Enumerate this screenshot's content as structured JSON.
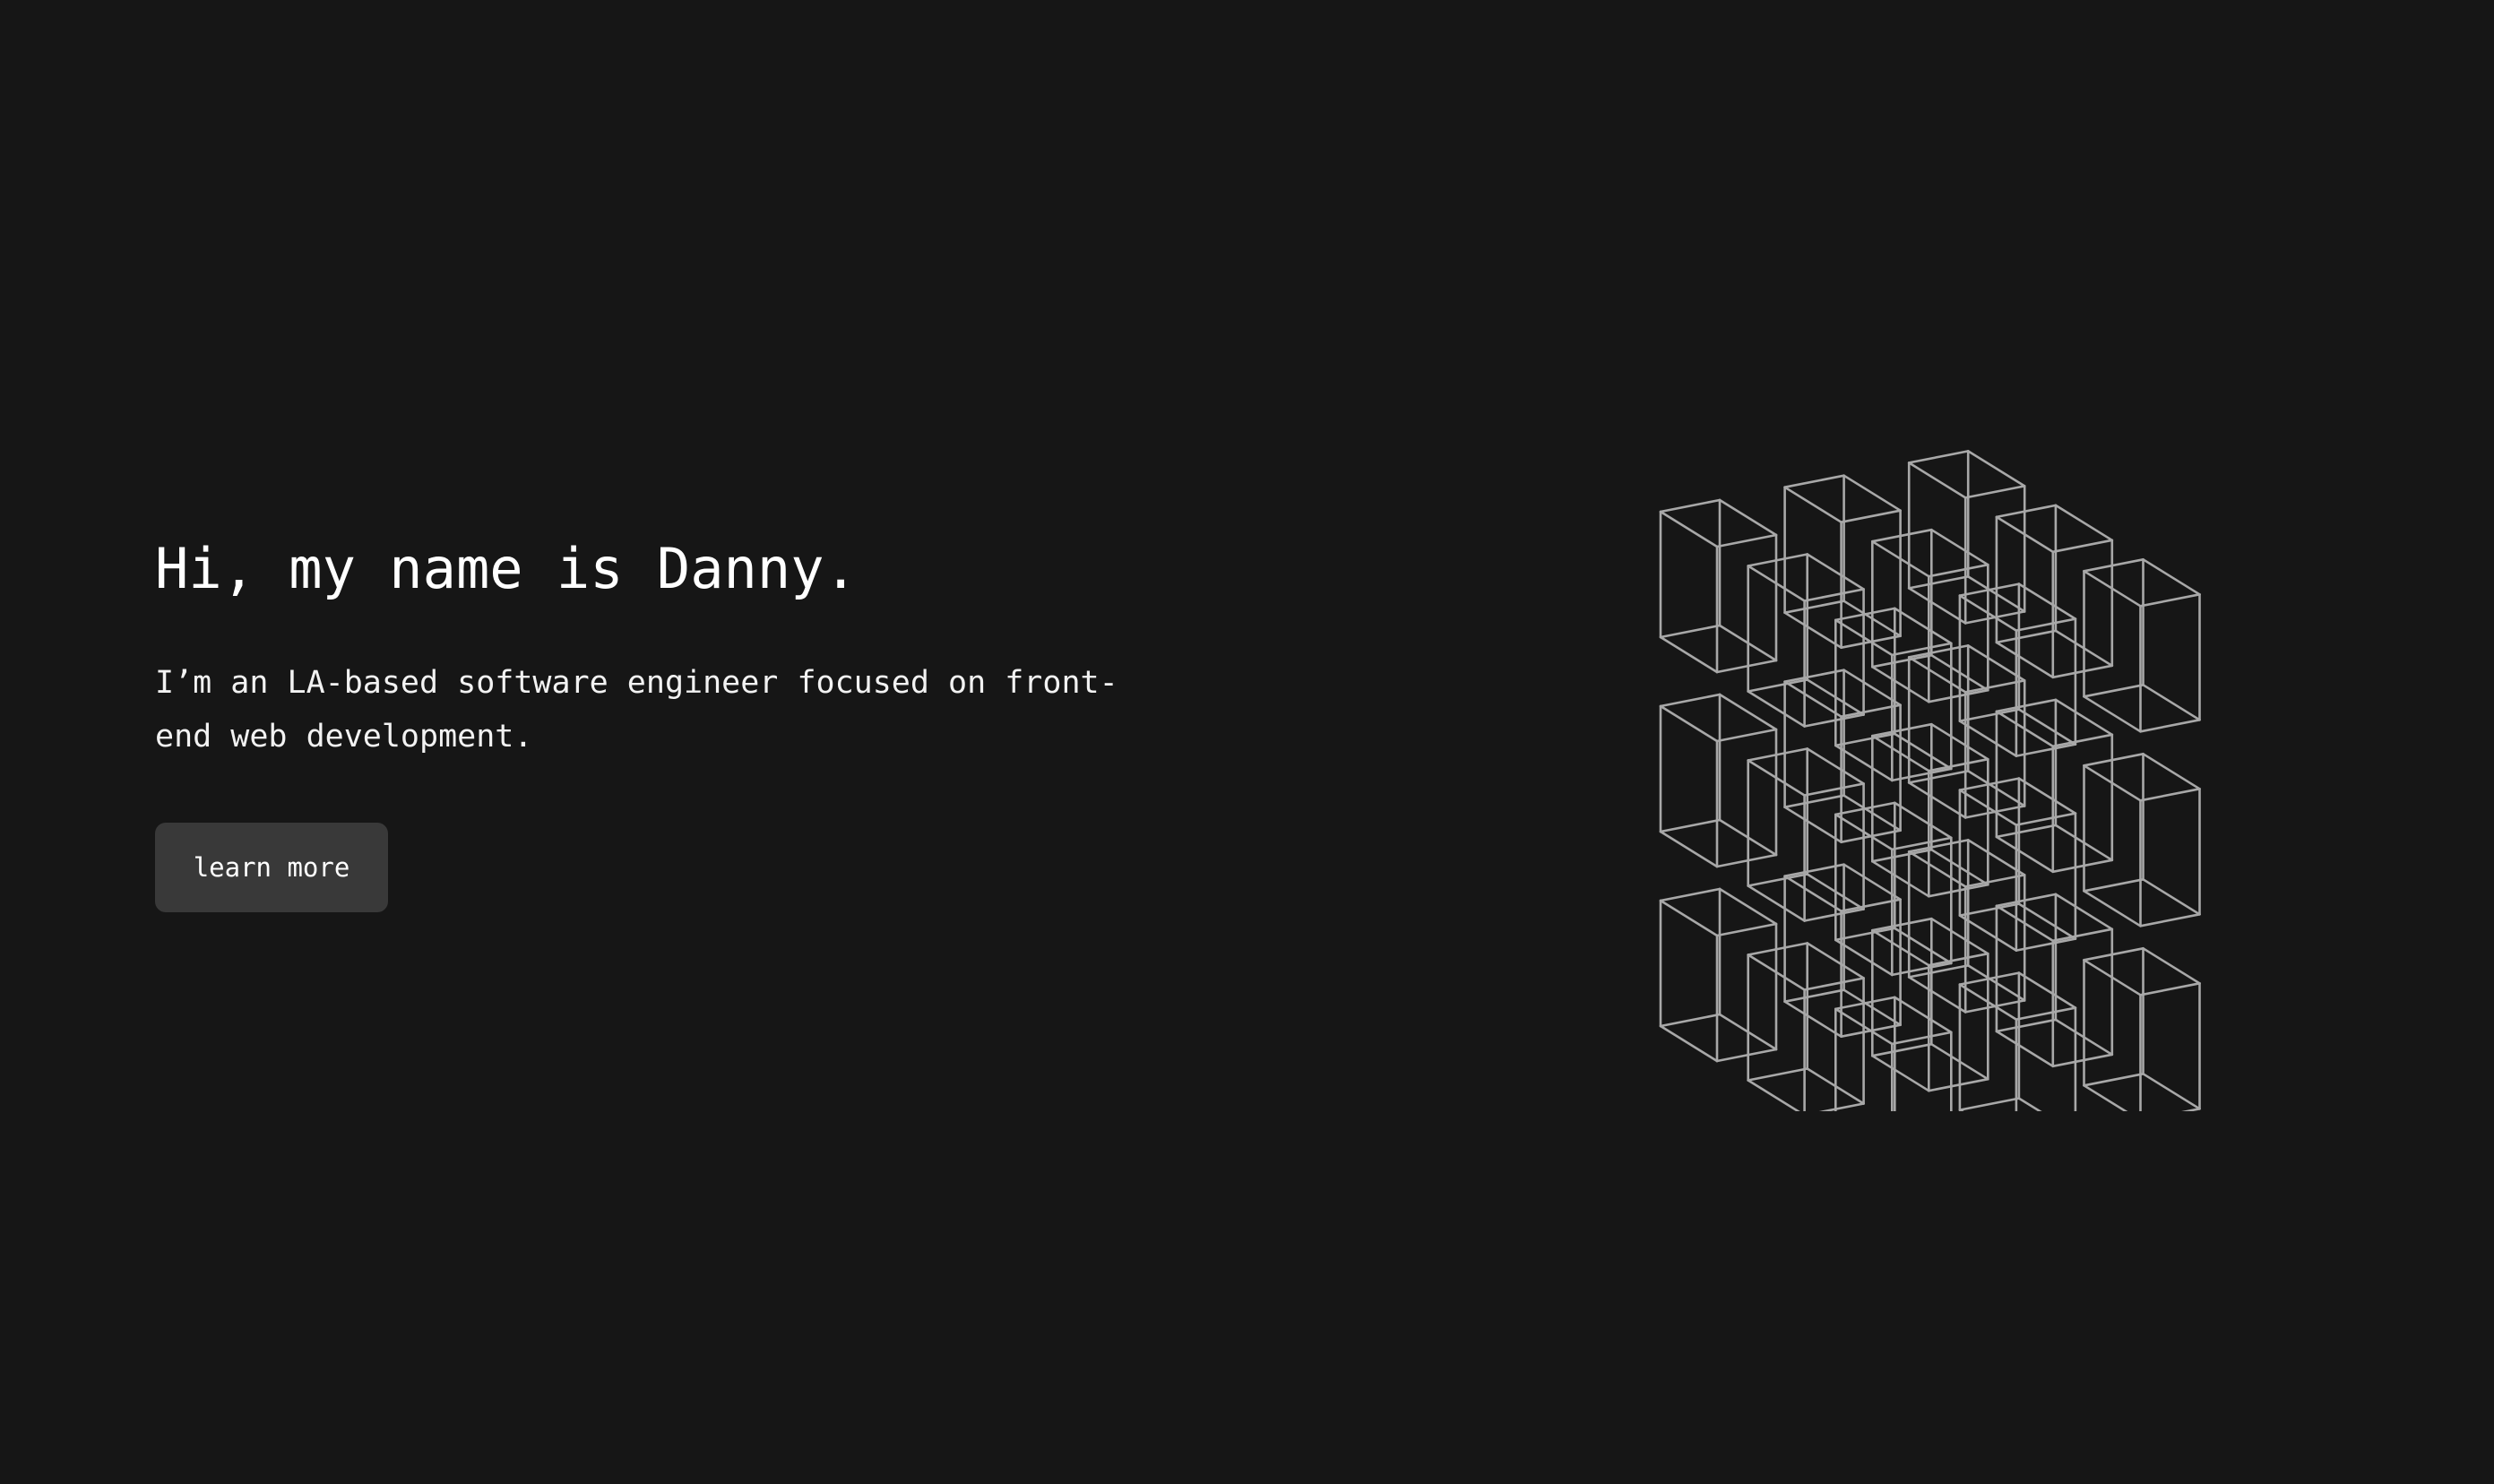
{
  "hero": {
    "title": "Hi, my name is Danny.",
    "text": "I’m an LA-based software engineer focused on front-end web development.",
    "button_label": "learn more"
  },
  "illustration": {
    "name": "wireframe-cube-lattice",
    "stroke_color": "#a8a8a8",
    "grid": [
      3,
      3,
      3
    ]
  },
  "colors": {
    "background": "#161616",
    "button_background": "#393939",
    "text": "#ffffff"
  }
}
